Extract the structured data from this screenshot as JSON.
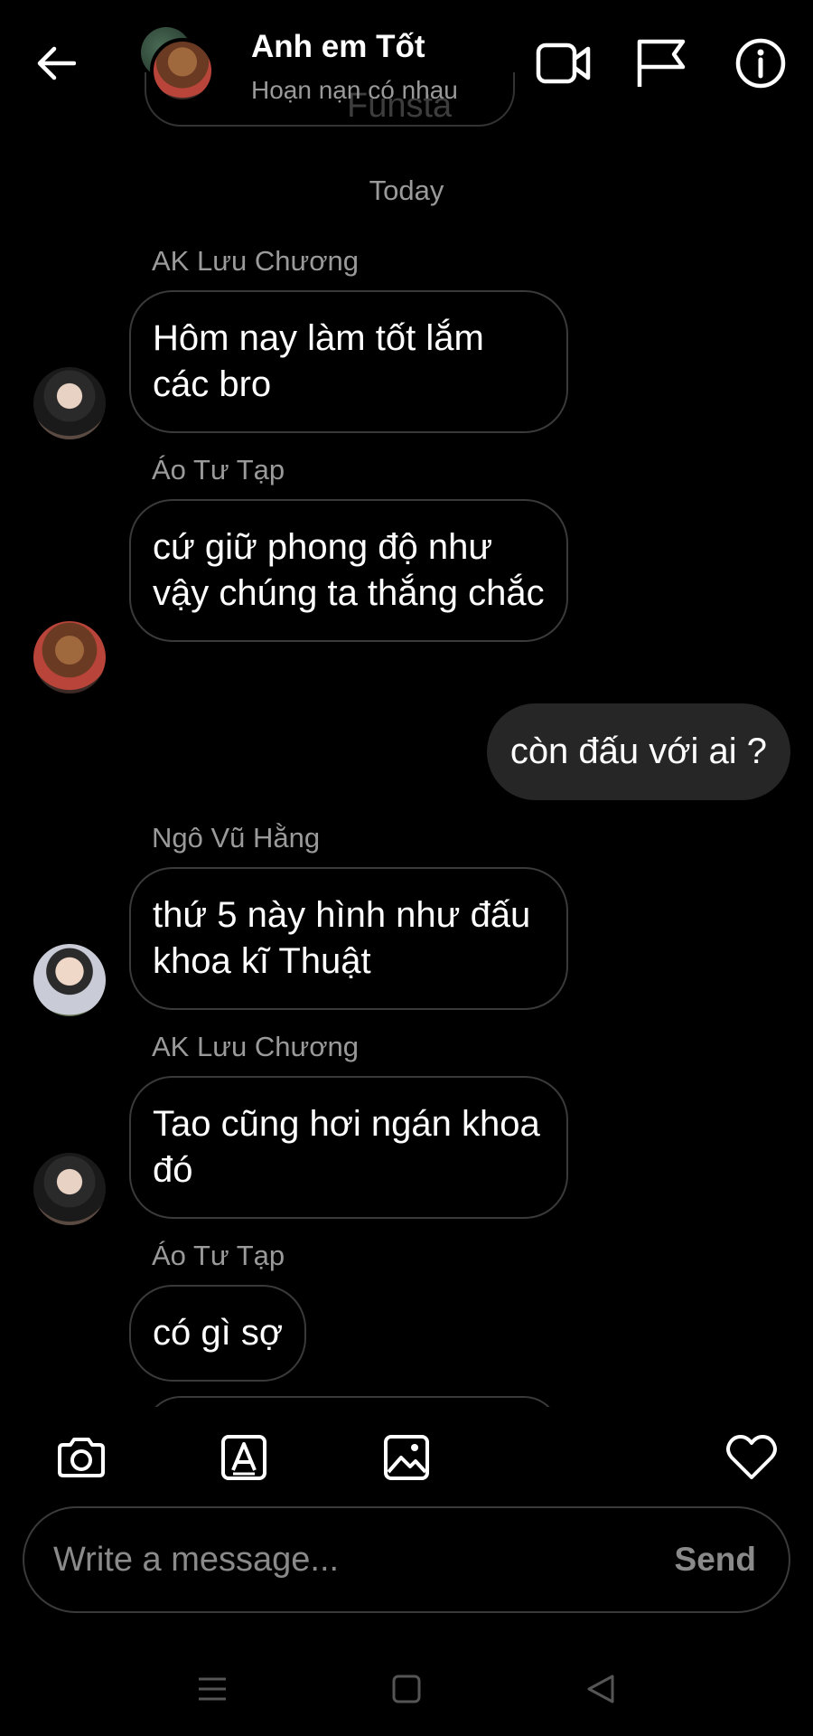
{
  "header": {
    "title": "Anh em Tốt",
    "subtitle": "Hoạn nạn có nhau",
    "ghost_text": "Funsta"
  },
  "chat": {
    "date_separator": "Today",
    "messages": [
      {
        "sender": "AK Lưu Chương",
        "text": "Hôm nay làm tốt lắm các bro",
        "avatar": "ak-avatar"
      },
      {
        "sender": "Áo Tư Tạp",
        "text": "cứ  giữ phong độ như vậy chúng ta thắng chắc",
        "avatar": "ao-avatar"
      },
      {
        "sender": "",
        "text": "còn đấu với ai ?",
        "outgoing": true
      },
      {
        "sender": "Ngô Vũ Hằng",
        "text": "thứ 5 này hình như đấu khoa kĩ Thuật",
        "avatar": "ngo-avatar"
      },
      {
        "sender": "AK Lưu Chương",
        "text": "Tao cũng hơi ngán khoa đó",
        "avatar": "ak-avatar"
      },
      {
        "sender": "Áo Tư Tạp",
        "text": "có gì sợ",
        "avatar": "ao-avatar"
      }
    ]
  },
  "composer": {
    "placeholder": "Write a message...",
    "send_label": "Send"
  },
  "icons": {
    "back": "arrow-left-icon",
    "video": "video-camera-icon",
    "flag": "flag-icon",
    "info": "info-icon",
    "camera": "camera-icon",
    "sticker": "sticker-icon",
    "gallery": "image-icon",
    "like": "heart-icon"
  },
  "colors": {
    "background": "#000000",
    "bubble_out": "#262626",
    "bubble_border": "#3a3a3a",
    "muted_text": "#9a9a9a"
  }
}
